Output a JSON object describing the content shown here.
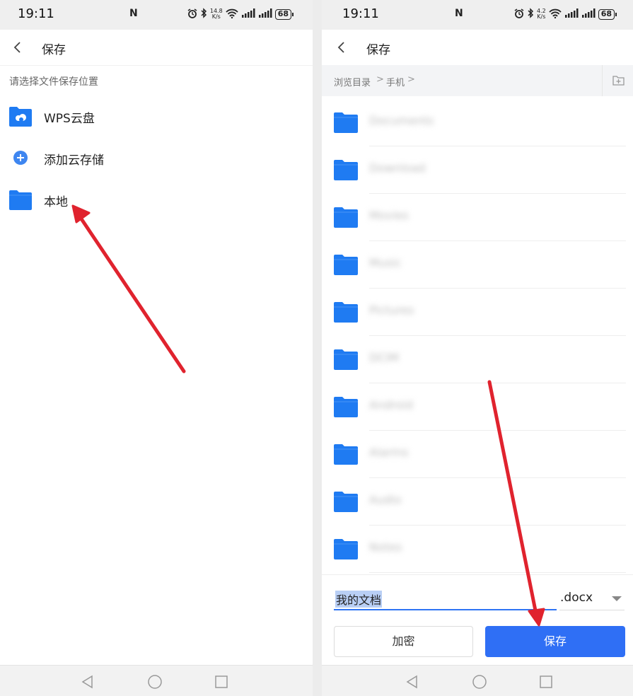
{
  "left_screen": {
    "status": {
      "time": "19:11",
      "nfc": "N",
      "speed_top": "14.8",
      "speed_bottom": "K/s",
      "battery": "68"
    },
    "appbar": {
      "title": "保存",
      "back_icon": "chevron-left-icon"
    },
    "hint": "请选择文件保存位置",
    "locations": [
      {
        "label": "WPS云盘",
        "icon": "cloud-folder-icon"
      },
      {
        "label": "添加云存储",
        "icon": "plus-circle-icon"
      },
      {
        "label": "本地",
        "icon": "folder-icon"
      }
    ]
  },
  "right_screen": {
    "status": {
      "time": "19:11",
      "nfc": "N",
      "speed_top": "4.2",
      "speed_bottom": "K/s",
      "battery": "68"
    },
    "appbar": {
      "title": "保存",
      "back_icon": "chevron-left-icon"
    },
    "breadcrumb": [
      "浏览目录",
      "手机"
    ],
    "breadcrumb_separator": ">",
    "folders": [
      {
        "name": "Documents"
      },
      {
        "name": "Download"
      },
      {
        "name": "Movies"
      },
      {
        "name": "Music"
      },
      {
        "name": "Pictures"
      },
      {
        "name": "DCIM"
      },
      {
        "name": "Android"
      },
      {
        "name": "Alarms"
      },
      {
        "name": "Audio"
      },
      {
        "name": "Notes"
      }
    ],
    "file_name": "我的文档",
    "extension": ".docx",
    "encrypt_label": "加密",
    "save_label": "保存"
  },
  "colors": {
    "accent": "#2f6ff5",
    "folder": "#1f7bf2",
    "annotation_arrow": "#e0232e"
  }
}
